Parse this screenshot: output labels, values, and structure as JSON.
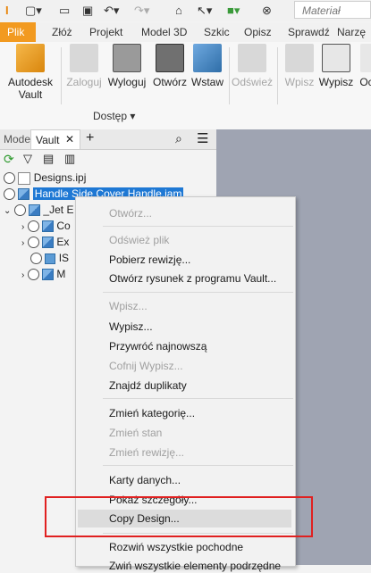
{
  "quick_access": {
    "icons": [
      "app-logo-icon",
      "new-file-icon",
      "open-folder-icon",
      "save-icon",
      "undo-icon",
      "redo-icon",
      "home-icon",
      "select-icon",
      "appearance-icon",
      "material-sphere-icon"
    ],
    "material_placeholder": "Materiał"
  },
  "tabs": [
    "Plik",
    "Złóż",
    "Projekt",
    "Model 3D",
    "Szkic",
    "Opisz",
    "Sprawdź",
    "Narzę"
  ],
  "ribbon": {
    "buttons": [
      {
        "label": "Autodesk\nVault",
        "disabled": false
      },
      {
        "label": "Zaloguj",
        "disabled": true
      },
      {
        "label": "Wyloguj",
        "disabled": false
      },
      {
        "label": "Otwórz",
        "disabled": false
      },
      {
        "label": "Wstaw",
        "disabled": false
      },
      {
        "label": "Odśwież",
        "disabled": true
      },
      {
        "label": "Wpisz",
        "disabled": true
      },
      {
        "label": "Wypisz",
        "disabled": false
      },
      {
        "label": "Oc",
        "disabled": false
      }
    ],
    "group_label": "Dostęp ▾"
  },
  "panel": {
    "tab_model": "Model",
    "tab_vault": "Vault",
    "close": "✕",
    "add": "+"
  },
  "tree": {
    "project": "Designs.ipj",
    "assembly": "Handle Side Cover Handle.iam",
    "sub": "_Jet E",
    "children": [
      "Co",
      "Ex",
      "IS",
      "M"
    ]
  },
  "menu": {
    "items": [
      {
        "label": "Otwórz...",
        "disabled": true
      },
      {
        "label": "Odśwież plik",
        "disabled": true
      },
      {
        "label": "Pobierz rewizję...",
        "disabled": false
      },
      {
        "label": "Otwórz rysunek z programu Vault...",
        "disabled": false
      },
      {
        "label": "Wpisz...",
        "disabled": true
      },
      {
        "label": "Wypisz...",
        "disabled": false
      },
      {
        "label": "Przywróć najnowszą",
        "disabled": false
      },
      {
        "label": "Cofnij Wypisz...",
        "disabled": true
      },
      {
        "label": "Znajdź duplikaty",
        "disabled": false
      },
      {
        "label": "Zmień kategorię...",
        "disabled": false
      },
      {
        "label": "Zmień stan",
        "disabled": true
      },
      {
        "label": "Zmień rewizję...",
        "disabled": true
      },
      {
        "label": "Karty danych...",
        "disabled": false
      },
      {
        "label": "Pokaż szczegóły...",
        "disabled": false
      },
      {
        "label": "Copy Design...",
        "disabled": false
      },
      {
        "label": "Rozwiń wszystkie pochodne",
        "disabled": false
      },
      {
        "label": "Zwiń wszystkie elementy podrzędne",
        "disabled": false
      }
    ]
  },
  "colors": {
    "accent": "#f29a20",
    "selection": "#1e78d4",
    "highlight_box": "#e02020"
  }
}
